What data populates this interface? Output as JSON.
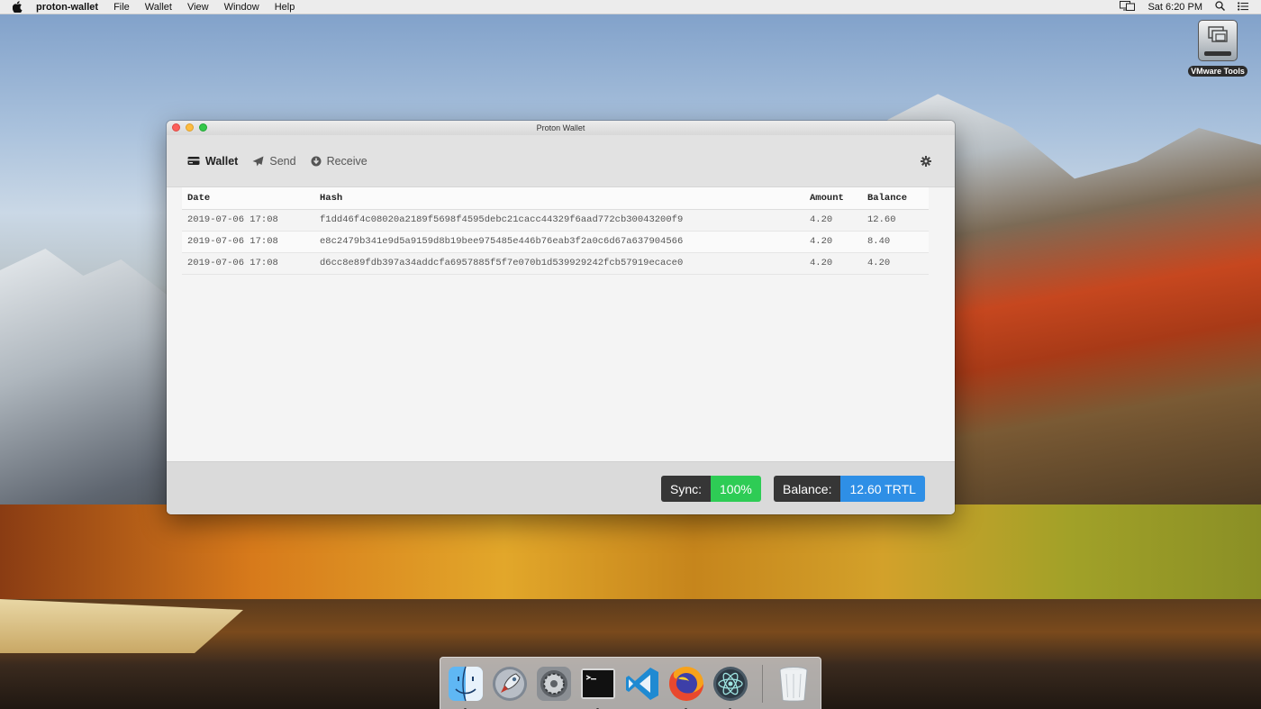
{
  "menubar": {
    "app_name": "proton-wallet",
    "items": [
      "File",
      "Wallet",
      "View",
      "Window",
      "Help"
    ],
    "clock": "Sat 6:20 PM"
  },
  "desktop_icon": {
    "label": "VMware Tools"
  },
  "window": {
    "title": "Proton Wallet",
    "tabs": [
      {
        "label": "Wallet",
        "icon": "wallet-icon",
        "active": true
      },
      {
        "label": "Send",
        "icon": "send-icon",
        "active": false
      },
      {
        "label": "Receive",
        "icon": "receive-icon",
        "active": false
      }
    ],
    "table": {
      "headers": [
        "Date",
        "Hash",
        "Amount",
        "Balance"
      ],
      "rows": [
        {
          "date": "2019-07-06 17:08",
          "hash": "f1dd46f4c08020a2189f5698f4595debc21cacc44329f6aad772cb30043200f9",
          "amount": "4.20",
          "balance": "12.60"
        },
        {
          "date": "2019-07-06 17:08",
          "hash": "e8c2479b341e9d5a9159d8b19bee975485e446b76eab3f2a0c6d67a637904566",
          "amount": "4.20",
          "balance": "8.40"
        },
        {
          "date": "2019-07-06 17:08",
          "hash": "d6cc8e89fdb397a34addcfa6957885f5f7e070b1d539929242fcb57919ecace0",
          "amount": "4.20",
          "balance": "4.20"
        }
      ]
    },
    "footer": {
      "sync_label": "Sync:",
      "sync_value": "100%",
      "balance_label": "Balance:",
      "balance_value": "12.60 TRTL"
    }
  },
  "dock": {
    "items": [
      "finder-icon",
      "launchpad-icon",
      "system-preferences-icon",
      "terminal-icon",
      "vscode-icon",
      "firefox-icon",
      "atom-icon",
      "trash-icon"
    ]
  },
  "colors": {
    "sync_green": "#2ecc55",
    "balance_blue": "#2e8fe6",
    "pill_dark": "#363636"
  }
}
